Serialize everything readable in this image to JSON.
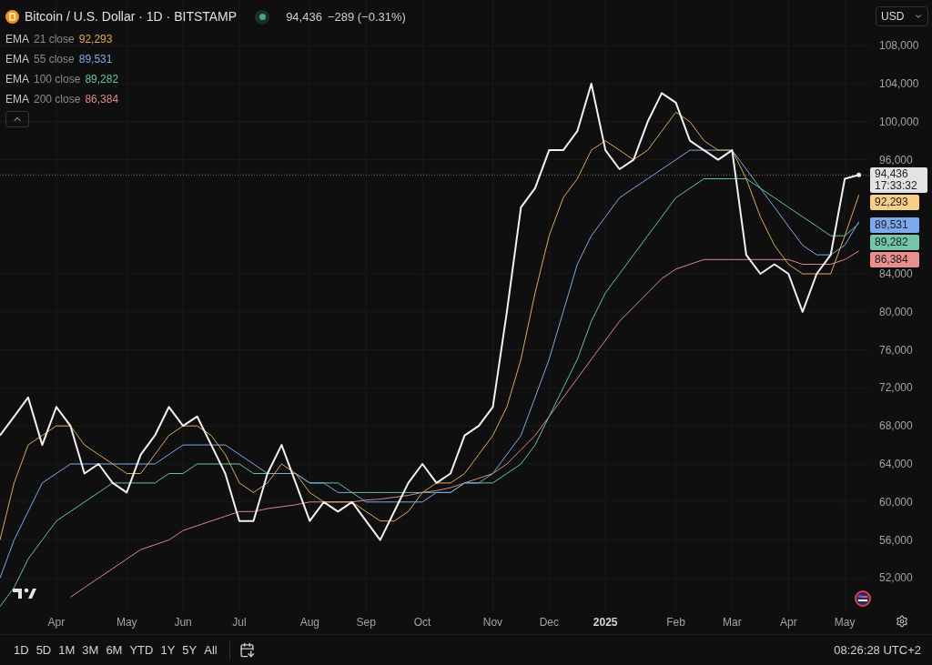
{
  "header": {
    "title": "Bitcoin / U.S. Dollar · 1D · BITSTAMP",
    "market_open": true,
    "price": "94,436",
    "change": "−289 (−0.31%)"
  },
  "legend": [
    {
      "name": "EMA",
      "params": "21 close",
      "value": "92,293",
      "color": "#e0a85c"
    },
    {
      "name": "EMA",
      "params": "55 close",
      "value": "89,531",
      "color": "#7fa9e6"
    },
    {
      "name": "EMA",
      "params": "100 close",
      "value": "89,282",
      "color": "#62c2a6"
    },
    {
      "name": "EMA",
      "params": "200 close",
      "value": "86,384",
      "color": "#e08686"
    }
  ],
  "currency": "USD",
  "price_badge": {
    "price": "94,436",
    "countdown": "17:33:32"
  },
  "value_badges": [
    {
      "text": "92,293",
      "color": "#f7cf88"
    },
    {
      "text": "89,531",
      "color": "#7ea9ef"
    },
    {
      "text": "89,282",
      "color": "#73c6a9"
    },
    {
      "text": "86,384",
      "color": "#ea8f8f"
    }
  ],
  "chart_data": {
    "type": "line",
    "ylim": [
      48500,
      112800
    ],
    "categories": [
      null,
      null,
      null,
      null,
      "Apr",
      null,
      null,
      null,
      null,
      "May",
      null,
      null,
      null,
      "Jun",
      null,
      null,
      null,
      "Jul",
      null,
      null,
      null,
      null,
      "Aug",
      null,
      null,
      null,
      "Sep",
      null,
      null,
      null,
      "Oct",
      null,
      null,
      null,
      null,
      "Nov",
      null,
      null,
      null,
      "Dec",
      null,
      null,
      null,
      "2025",
      null,
      null,
      null,
      null,
      "Feb",
      null,
      null,
      null,
      "Mar",
      null,
      null,
      null,
      "Apr",
      null,
      null,
      null,
      "May",
      null
    ],
    "series": [
      {
        "color": "#f2f2f2",
        "values": [
          67000,
          69000,
          71000,
          66000,
          70000,
          68000,
          63000,
          64000,
          62000,
          61000,
          65000,
          67000,
          70000,
          68000,
          69000,
          66000,
          63000,
          58000,
          58000,
          63000,
          66000,
          62000,
          58000,
          60000,
          59000,
          60000,
          58000,
          56000,
          59000,
          62000,
          64000,
          62000,
          63000,
          67000,
          68000,
          70000,
          80000,
          91000,
          93000,
          97000,
          97000,
          99000,
          104000,
          97000,
          95000,
          96000,
          100000,
          103000,
          102000,
          98000,
          97000,
          96000,
          97000,
          86000,
          84000,
          85000,
          84000,
          80000,
          84000,
          86000,
          94000,
          94400
        ]
      },
      {
        "color": "#e0a85c",
        "values": [
          56000,
          62000,
          66000,
          67000,
          68000,
          68000,
          66000,
          65000,
          64000,
          63000,
          63000,
          65000,
          67000,
          68000,
          68000,
          67000,
          65000,
          62000,
          61000,
          62000,
          64000,
          63000,
          61000,
          60000,
          60000,
          60000,
          59000,
          58000,
          58000,
          59000,
          61000,
          62000,
          62000,
          63000,
          65000,
          67000,
          70000,
          75000,
          82000,
          88000,
          92000,
          94000,
          97000,
          98000,
          97000,
          96000,
          97000,
          99000,
          101000,
          100000,
          98000,
          97000,
          97000,
          94000,
          90000,
          87000,
          85000,
          84000,
          84000,
          84000,
          88000,
          92300
        ]
      },
      {
        "color": "#7fa9e6",
        "values": [
          52000,
          56000,
          59000,
          62000,
          63000,
          64000,
          64000,
          64000,
          64000,
          64000,
          64000,
          64000,
          65000,
          66000,
          66000,
          66000,
          66000,
          65000,
          64000,
          63000,
          63000,
          63000,
          62000,
          62000,
          61000,
          61000,
          60000,
          60000,
          60000,
          60000,
          60000,
          61000,
          61000,
          62000,
          62000,
          63000,
          65000,
          67000,
          71000,
          75000,
          80000,
          85000,
          88000,
          90000,
          92000,
          93000,
          94000,
          95000,
          96000,
          97000,
          97000,
          97000,
          97000,
          95000,
          93000,
          91000,
          89000,
          87000,
          86000,
          86000,
          87000,
          89500
        ]
      },
      {
        "color": "#62c2a6",
        "values": [
          49000,
          51000,
          54000,
          56000,
          58000,
          59000,
          60000,
          61000,
          62000,
          62000,
          62000,
          62000,
          63000,
          63000,
          64000,
          64000,
          64000,
          64000,
          63000,
          63000,
          63000,
          63000,
          62000,
          62000,
          62000,
          61000,
          61000,
          61000,
          61000,
          61000,
          61000,
          61000,
          61000,
          62000,
          62000,
          62000,
          63000,
          64000,
          66000,
          69000,
          72000,
          75000,
          79000,
          82000,
          84000,
          86000,
          88000,
          90000,
          92000,
          93000,
          94000,
          94000,
          94000,
          94000,
          93000,
          92000,
          91000,
          90000,
          89000,
          88000,
          88000,
          89300
        ]
      },
      {
        "color": "#e08686",
        "values": [
          null,
          null,
          null,
          null,
          null,
          50000,
          51000,
          52000,
          53000,
          54000,
          55000,
          55500,
          56000,
          57000,
          57500,
          58000,
          58500,
          59000,
          59000,
          59300,
          59500,
          59700,
          60000,
          60000,
          60000,
          60000,
          60200,
          60300,
          60500,
          60700,
          61000,
          61200,
          61500,
          62000,
          62500,
          63000,
          64000,
          65500,
          67000,
          69000,
          71000,
          73000,
          75000,
          77000,
          79000,
          80500,
          82000,
          83500,
          84500,
          85000,
          85500,
          85500,
          85500,
          85500,
          85500,
          85500,
          85500,
          85000,
          85000,
          85000,
          85500,
          86400
        ]
      }
    ],
    "yticks": [
      {
        "value": 52000,
        "label": "52,000"
      },
      {
        "value": 56000,
        "label": "56,000"
      },
      {
        "value": 60000,
        "label": "60,000"
      },
      {
        "value": 64000,
        "label": "64,000"
      },
      {
        "value": 68000,
        "label": "68,000"
      },
      {
        "value": 72000,
        "label": "72,000"
      },
      {
        "value": 76000,
        "label": "76,000"
      },
      {
        "value": 80000,
        "label": "80,000"
      },
      {
        "value": 84000,
        "label": "84,000"
      },
      {
        "value": 96000,
        "label": "96,000"
      },
      {
        "value": 100000,
        "label": "100,000"
      },
      {
        "value": 104000,
        "label": "104,000"
      },
      {
        "value": 108000,
        "label": "108,000"
      }
    ],
    "grid": true,
    "ref_lines": [
      {
        "axis": "y",
        "value": 94400
      }
    ]
  },
  "ranges": [
    {
      "label": "1D",
      "selected": false
    },
    {
      "label": "5D",
      "selected": false
    },
    {
      "label": "1M",
      "selected": false
    },
    {
      "label": "3M",
      "selected": false
    },
    {
      "label": "6M",
      "selected": false
    },
    {
      "label": "YTD",
      "selected": false
    },
    {
      "label": "1Y",
      "selected": false
    },
    {
      "label": "5Y",
      "selected": false
    },
    {
      "label": "All",
      "selected": false
    }
  ],
  "clock": "08:26:28 UTC+2"
}
